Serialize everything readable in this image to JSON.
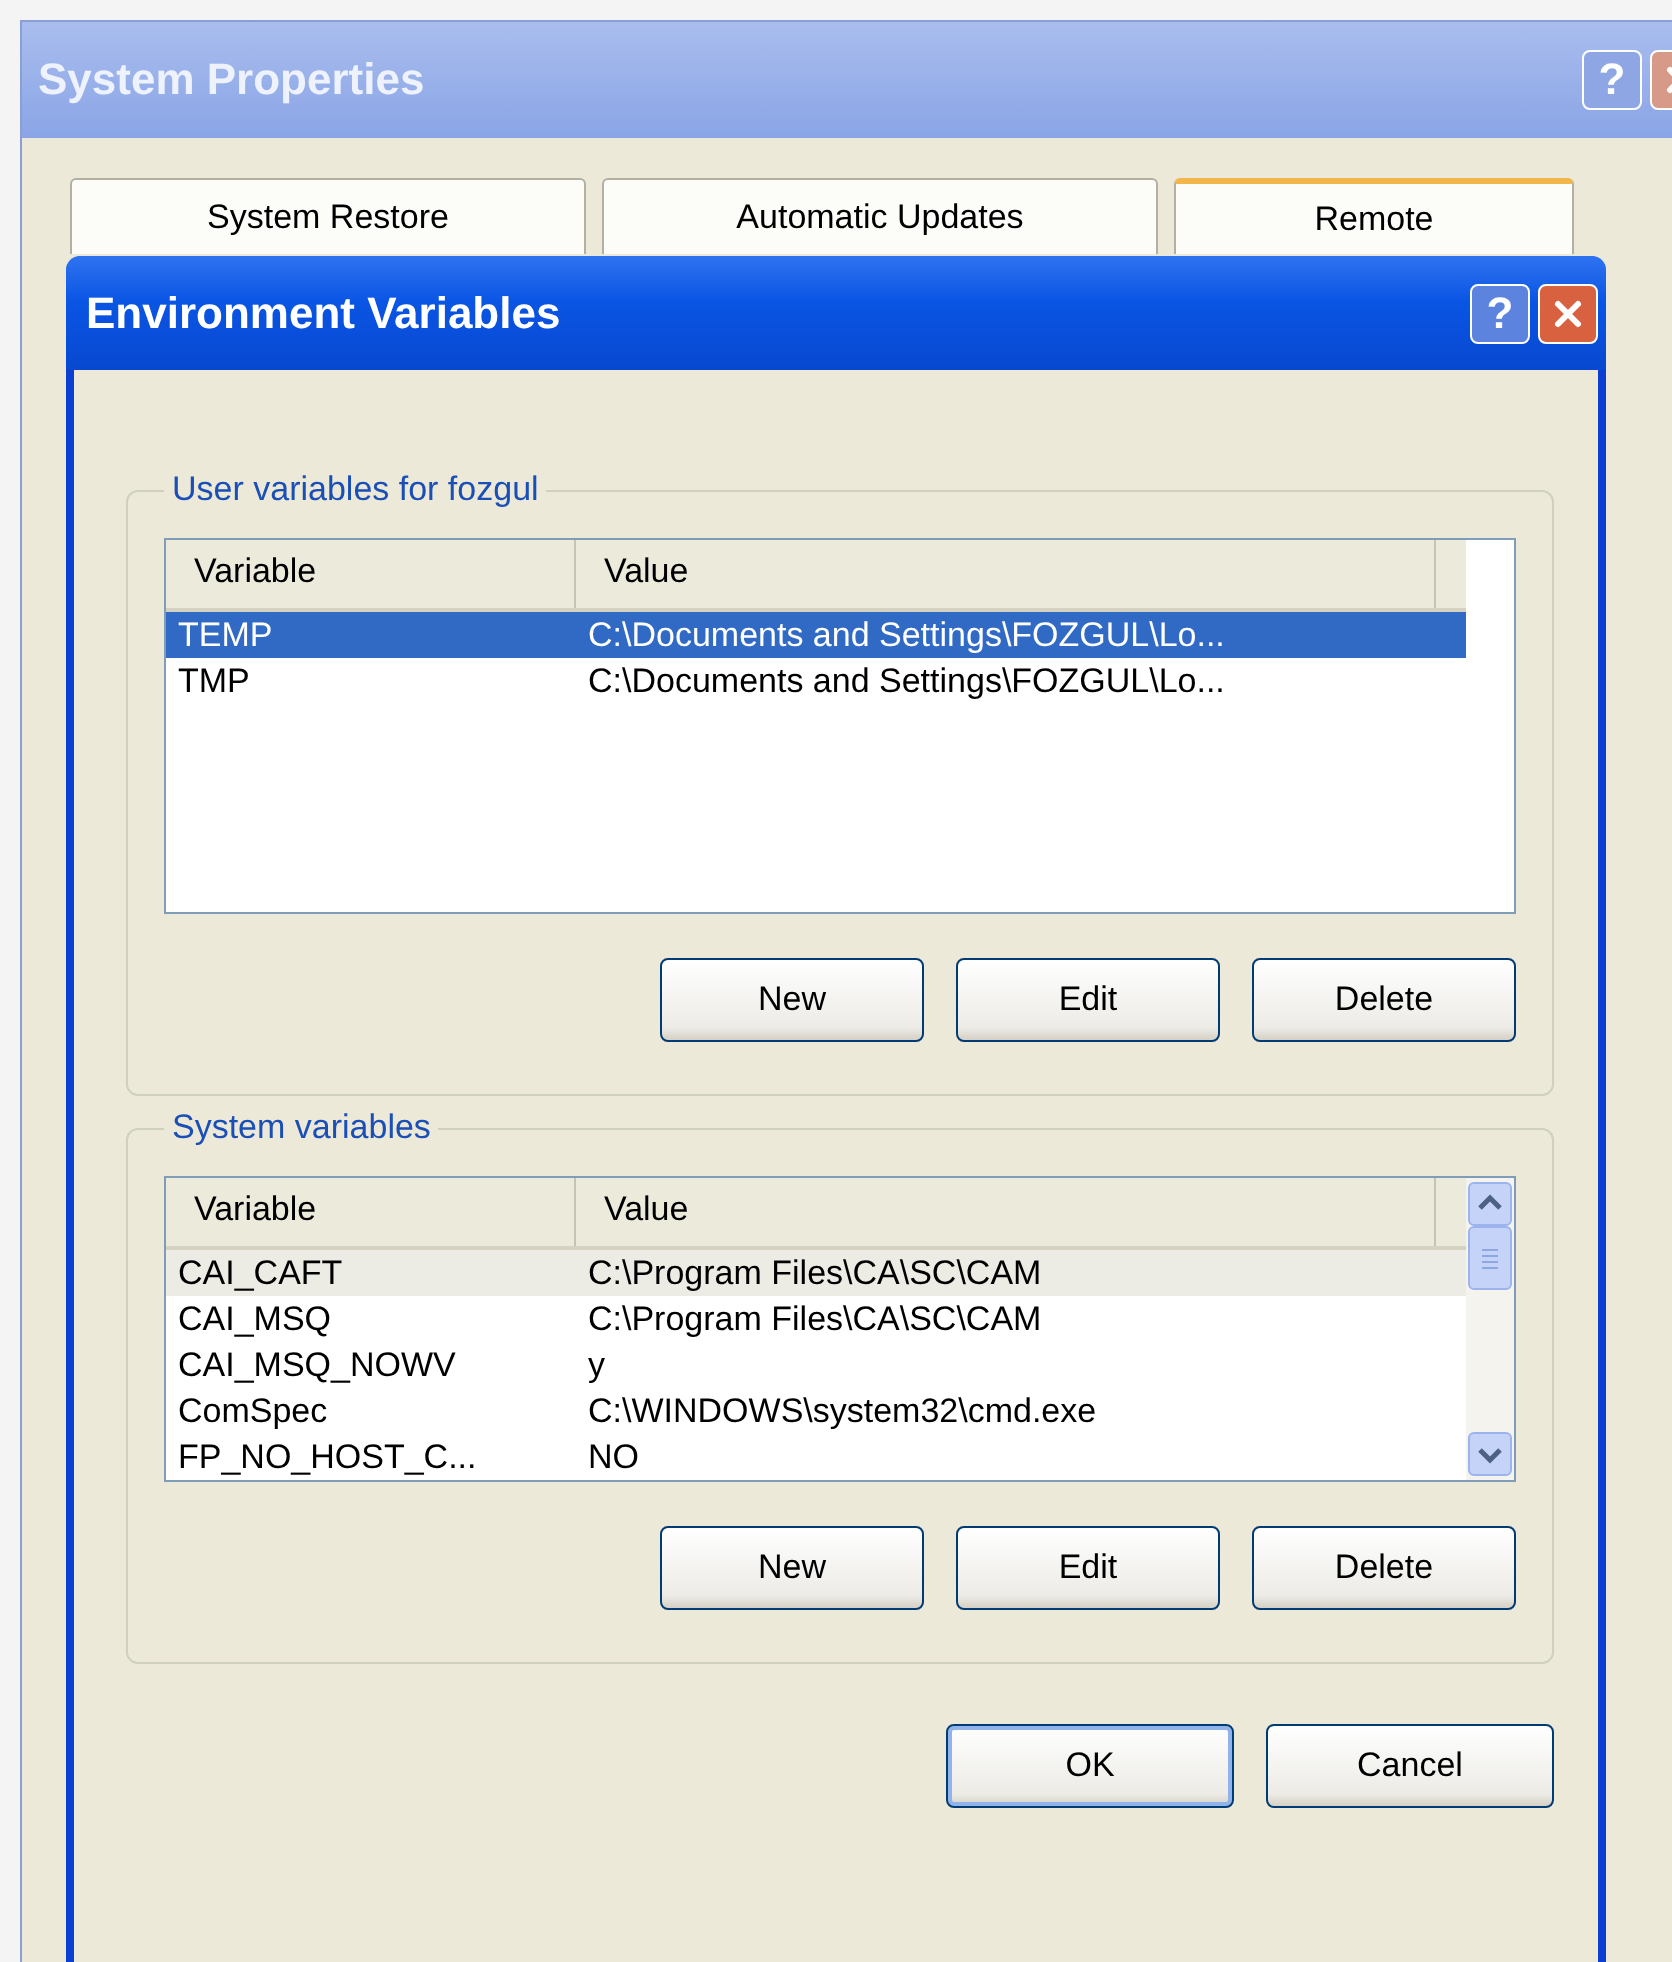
{
  "outer_window": {
    "title": "System Properties",
    "help_button": "?",
    "tabs": [
      {
        "label": "System Restore",
        "selected": false
      },
      {
        "label": "Automatic Updates",
        "selected": false
      },
      {
        "label": "Remote",
        "selected": true
      }
    ]
  },
  "dialog": {
    "title": "Environment Variables",
    "help_button": "?",
    "user_variables": {
      "label": "User variables for fozgul",
      "focused": true,
      "columns": [
        "Variable",
        "Value"
      ],
      "rows": [
        {
          "variable": "TEMP",
          "value": "C:\\Documents and Settings\\FOZGUL\\Lo...",
          "selected": true
        },
        {
          "variable": "TMP",
          "value": "C:\\Documents and Settings\\FOZGUL\\Lo...",
          "selected": false
        }
      ],
      "buttons": [
        "New",
        "Edit",
        "Delete"
      ]
    },
    "system_variables": {
      "label": "System variables",
      "focused": false,
      "columns": [
        "Variable",
        "Value"
      ],
      "rows": [
        {
          "variable": "CAI_CAFT",
          "value": "C:\\Program Files\\CA\\SC\\CAM",
          "selected": true
        },
        {
          "variable": "CAI_MSQ",
          "value": "C:\\Program Files\\CA\\SC\\CAM",
          "selected": false
        },
        {
          "variable": "CAI_MSQ_NOWV",
          "value": "y",
          "selected": false
        },
        {
          "variable": "ComSpec",
          "value": "C:\\WINDOWS\\system32\\cmd.exe",
          "selected": false
        },
        {
          "variable": "FP_NO_HOST_C...",
          "value": "NO",
          "selected": false
        }
      ],
      "buttons": [
        "New",
        "Edit",
        "Delete"
      ]
    },
    "buttons": [
      {
        "label": "OK",
        "default": true
      },
      {
        "label": "Cancel",
        "default": false
      }
    ]
  }
}
